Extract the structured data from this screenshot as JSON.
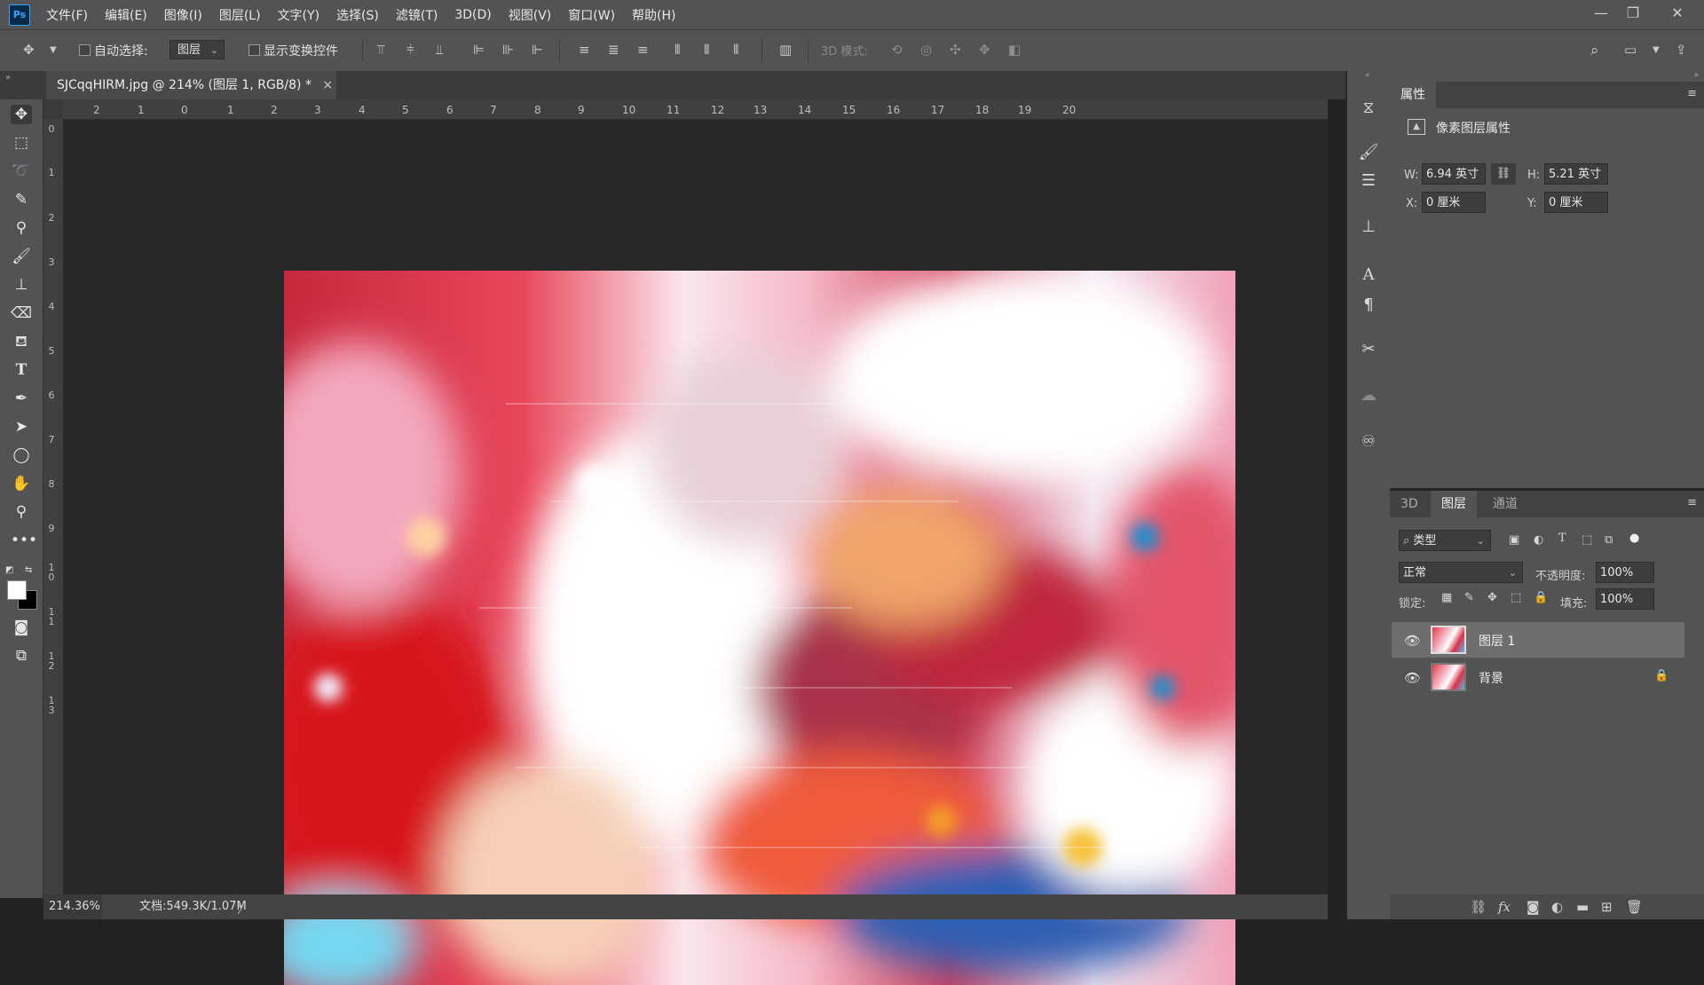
{
  "app": {
    "logo": "Ps"
  },
  "menu": [
    "文件(F)",
    "编辑(E)",
    "图像(I)",
    "图层(L)",
    "文字(Y)",
    "选择(S)",
    "滤镜(T)",
    "3D(D)",
    "视图(V)",
    "窗口(W)",
    "帮助(H)"
  ],
  "window_controls": {
    "minimize": "—",
    "restore": "❐",
    "close": "✕"
  },
  "options": {
    "auto_select_label": "自动选择:",
    "auto_select_value": "图层",
    "show_transform_label": "显示变换控件",
    "mode_3d_label": "3D 模式:"
  },
  "document": {
    "tab_title": "SJCqqHIRM.jpg @ 214% (图层 1, RGB/8) *",
    "close_glyph": "×"
  },
  "ruler": {
    "h_labels": [
      "1",
      "2",
      "1",
      "0",
      "1",
      "2",
      "3",
      "4",
      "5",
      "6",
      "7",
      "8",
      "9",
      "10",
      "11",
      "12",
      "13",
      "14",
      "15",
      "16",
      "17",
      "18",
      "19",
      "20"
    ],
    "v_labels": [
      "0",
      "1",
      "2",
      "3",
      "4",
      "5",
      "6",
      "7",
      "8",
      "9",
      "1 0",
      "1 1",
      "1 2",
      "1 3"
    ]
  },
  "status": {
    "zoom": "214.36%",
    "doc_info": "文档:549.3K/1.07M",
    "arrow": "〉"
  },
  "properties": {
    "tab": "属性",
    "section": "像素图层属性",
    "w_label": "W:",
    "w_value": "6.94 英寸",
    "h_label": "H:",
    "h_value": "5.21 英寸",
    "x_label": "X:",
    "x_value": "0 厘米",
    "y_label": "Y:",
    "y_value": "0 厘米"
  },
  "layers_panel": {
    "tabs": [
      "3D",
      "图层",
      "通道"
    ],
    "active_tab": 1,
    "filter_kind": "类型",
    "blend_mode": "正常",
    "opacity_label": "不透明度:",
    "opacity_value": "100%",
    "lock_label": "锁定:",
    "fill_label": "填充:",
    "fill_value": "100%",
    "layers": [
      {
        "name": "图层 1",
        "selected": true,
        "locked": false
      },
      {
        "name": "背景",
        "selected": false,
        "locked": true
      }
    ]
  },
  "colors": {
    "ui_bg": "#535353",
    "canvas_bg": "#282828",
    "selected_layer": "#6e6e6e",
    "accent": "#31a8ff"
  }
}
